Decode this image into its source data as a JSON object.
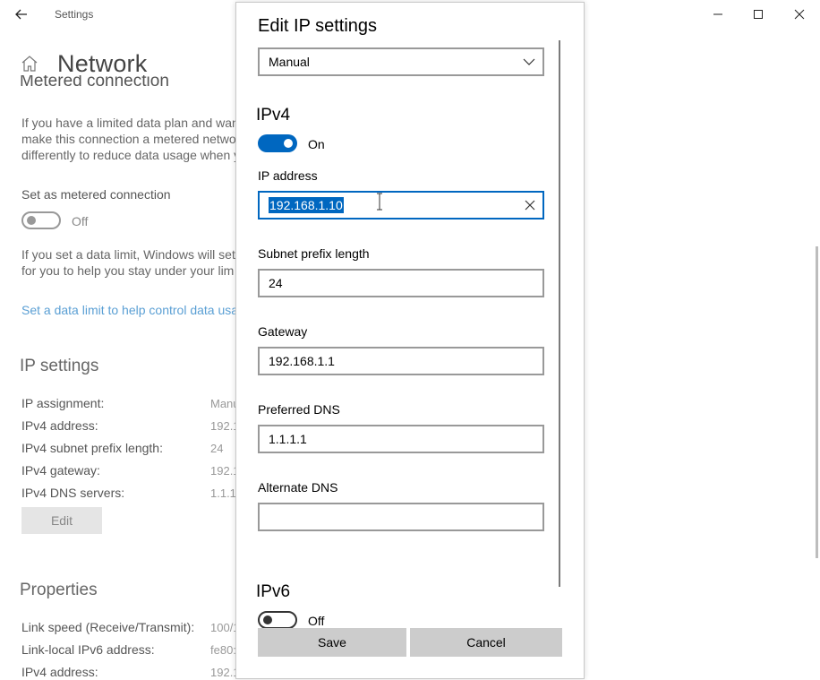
{
  "window": {
    "app_title": "Settings",
    "page_title": "Network"
  },
  "background": {
    "metered_heading": "Metered connection",
    "metered_paragraph": [
      "If you have a limited data plan and wan",
      "make this connection a metered netwo",
      "differently to reduce data usage when y"
    ],
    "set_metered_label": "Set as metered connection",
    "metered_toggle_state": "Off",
    "data_limit_paragraph": [
      "If you set a data limit, Windows will set",
      "for you to help you stay under your lim"
    ],
    "data_limit_link": "Set a data limit to help control data usa",
    "ip_settings_heading": "IP settings",
    "ip_rows": [
      {
        "label": "IP assignment:",
        "value": "Manu"
      },
      {
        "label": "IPv4 address:",
        "value": "192.1"
      },
      {
        "label": "IPv4 subnet prefix length:",
        "value": "24"
      },
      {
        "label": "IPv4 gateway:",
        "value": "192.1"
      },
      {
        "label": "IPv4 DNS servers:",
        "value": "1.1.1.1"
      }
    ],
    "edit_button": "Edit",
    "properties_heading": "Properties",
    "prop_rows": [
      {
        "label": "Link speed (Receive/Transmit):",
        "value": "100/1"
      },
      {
        "label": "Link-local IPv6 address:",
        "value": "fe80:"
      },
      {
        "label": "IPv4 address:",
        "value": "192.1"
      }
    ]
  },
  "dialog": {
    "title": "Edit IP settings",
    "mode_select": "Manual",
    "ipv4_heading": "IPv4",
    "ipv4_toggle_state": "On",
    "fields": {
      "ip_address": {
        "label": "IP address",
        "value": "192.168.1.10"
      },
      "subnet": {
        "label": "Subnet prefix length",
        "value": "24"
      },
      "gateway": {
        "label": "Gateway",
        "value": "192.168.1.1"
      },
      "preferred_dns": {
        "label": "Preferred DNS",
        "value": "1.1.1.1"
      },
      "alternate_dns": {
        "label": "Alternate DNS",
        "value": ""
      }
    },
    "ipv6_heading": "IPv6",
    "ipv6_toggle_state": "Off",
    "save_button": "Save",
    "cancel_button": "Cancel"
  },
  "colors": {
    "accent": "#0067c0",
    "link": "#5a9fd4",
    "button_bg": "#cccccc"
  },
  "icons": [
    "back-arrow-icon",
    "home-icon",
    "minimize-icon",
    "maximize-icon",
    "close-icon",
    "chevron-down-icon",
    "clear-icon",
    "text-cursor-icon"
  ]
}
